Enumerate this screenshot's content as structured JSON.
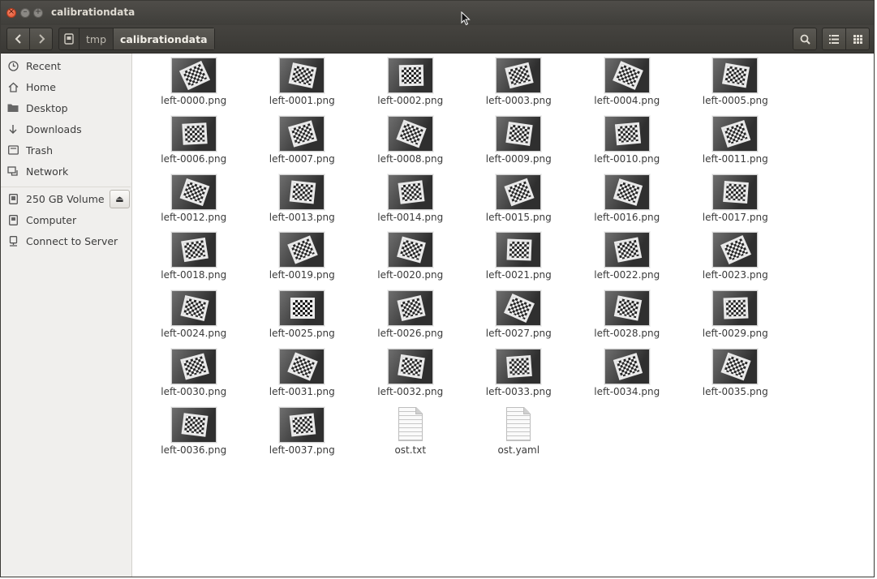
{
  "window": {
    "title": "calibrationdata"
  },
  "toolbar": {
    "back_icon": "chevron-left-icon",
    "forward_icon": "chevron-right-icon",
    "breadcrumbs": [
      "tmp",
      "calibrationdata"
    ],
    "search_icon": "search-icon",
    "list_view_icon": "list-view-icon",
    "grid_view_icon": "grid-view-icon"
  },
  "sidebar": {
    "places": [
      {
        "label": "Recent",
        "icon": "clock-icon"
      },
      {
        "label": "Home",
        "icon": "home-icon"
      },
      {
        "label": "Desktop",
        "icon": "folder-icon"
      },
      {
        "label": "Downloads",
        "icon": "download-icon"
      },
      {
        "label": "Trash",
        "icon": "trash-icon"
      },
      {
        "label": "Network",
        "icon": "network-icon"
      }
    ],
    "devices": [
      {
        "label": "250 GB Volume",
        "icon": "drive-icon"
      },
      {
        "label": "Computer",
        "icon": "computer-icon"
      },
      {
        "label": "Connect to Server",
        "icon": "server-icon"
      }
    ]
  },
  "files": [
    "left-0000.png",
    "left-0001.png",
    "left-0002.png",
    "left-0003.png",
    "left-0004.png",
    "left-0005.png",
    "left-0006.png",
    "left-0007.png",
    "left-0008.png",
    "left-0009.png",
    "left-0010.png",
    "left-0011.png",
    "left-0012.png",
    "left-0013.png",
    "left-0014.png",
    "left-0015.png",
    "left-0016.png",
    "left-0017.png",
    "left-0018.png",
    "left-0019.png",
    "left-0020.png",
    "left-0021.png",
    "left-0022.png",
    "left-0023.png",
    "left-0024.png",
    "left-0025.png",
    "left-0026.png",
    "left-0027.png",
    "left-0028.png",
    "left-0029.png",
    "left-0030.png",
    "left-0031.png",
    "left-0032.png",
    "left-0033.png",
    "left-0034.png",
    "left-0035.png",
    "left-0036.png",
    "left-0037.png",
    "ost.txt",
    "ost.yaml"
  ]
}
